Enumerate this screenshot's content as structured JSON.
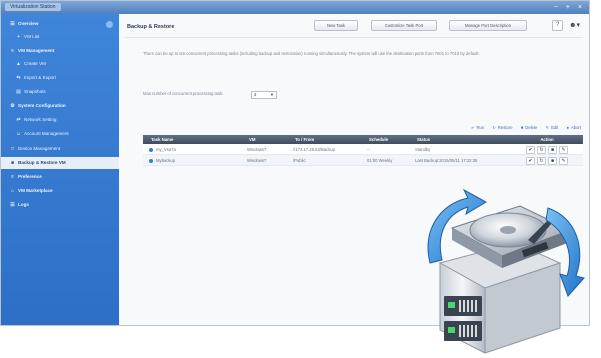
{
  "window": {
    "title": "Virtualization Station",
    "controls": "− + ×"
  },
  "sidebar": {
    "items": [
      {
        "label": "Overview",
        "icon": "☰"
      },
      {
        "label": "VM List",
        "icon": "+"
      },
      {
        "label": "VM Management",
        "icon": "≡"
      },
      {
        "label": "Create VM",
        "icon": "▲"
      },
      {
        "label": "Import & Export",
        "icon": "⇆"
      },
      {
        "label": "Snapshots",
        "icon": "▤"
      },
      {
        "label": "System Configuration",
        "icon": "⚙"
      },
      {
        "label": "Network Setting",
        "icon": "⇄"
      },
      {
        "label": "Account Management",
        "icon": "☺"
      },
      {
        "label": "Device Management",
        "icon": "□"
      },
      {
        "label": "Backup & Restore VM",
        "icon": "■"
      },
      {
        "label": "Preference",
        "icon": "≡"
      },
      {
        "label": "VM Marketplace",
        "icon": "⌂"
      },
      {
        "label": "Logs",
        "icon": "☰"
      }
    ]
  },
  "header": {
    "title": "Backup & Restore",
    "new_task": "New Task",
    "customize": "Customize Task Port",
    "manage": "Manage Port Description",
    "help": "?",
    "user": "☻▾"
  },
  "main": {
    "description": "There can be up to ten concurrent processing tasks (including backup and restoration) running simultaneously. The system will use the destination ports from 7001 to 7010 by default.",
    "limit_label": "Max number of concurrent processing task:",
    "limit_value": "3",
    "actions": {
      "run": "Run",
      "restore": "Restore",
      "delete": "Delete",
      "edit": "Edit",
      "abort": "Abort"
    },
    "table": {
      "headers": [
        "Task Name",
        "VM",
        "To / From",
        "Schedule",
        "Status",
        "Action"
      ],
      "rows": [
        {
          "name": "my_Vsa7a",
          "vm": "Windows7",
          "to_from": "//172.17.28.53/Backup",
          "schedule": "--",
          "status": "Standby"
        },
        {
          "name": "Mybackup",
          "vm": "Windows7",
          "to_from": "/Public",
          "schedule": "01:00 Weekly",
          "status": "Last Backup:2015/05/11 17:22:35"
        }
      ]
    }
  },
  "colors": {
    "sidebar": "#3a7fd5",
    "accent": "#2e7fd3",
    "table_header": "#4a586b"
  }
}
